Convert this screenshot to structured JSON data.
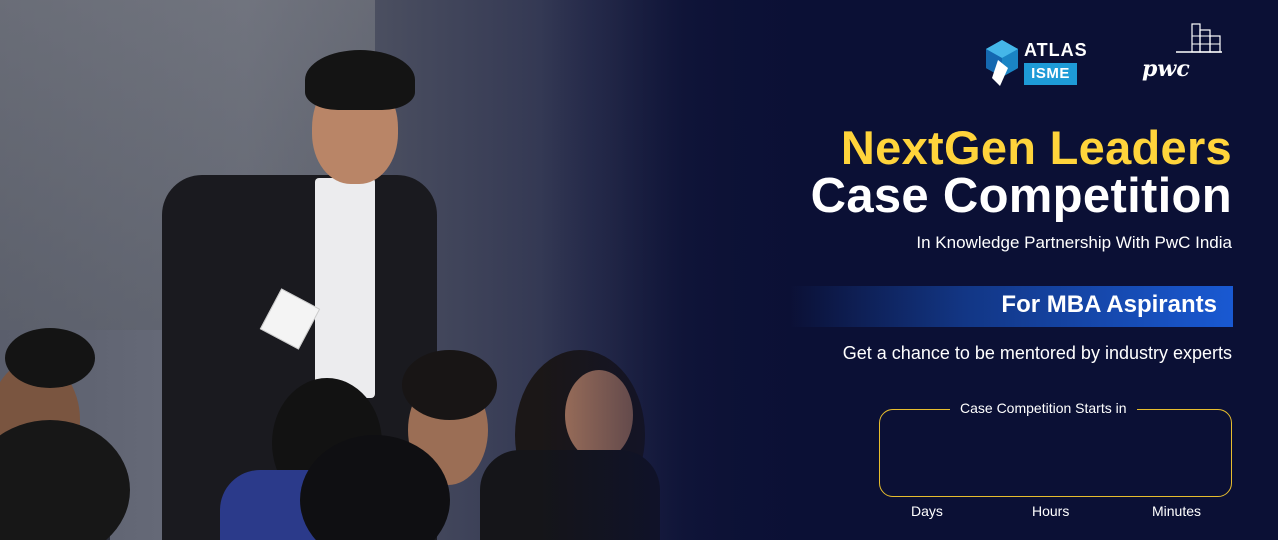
{
  "logos": {
    "atlas_word": "ATLAS",
    "isme_word": "ISME",
    "pwc_word": "pwc"
  },
  "heading": {
    "line1": "NextGen Leaders",
    "line2": "Case Competition",
    "subtitle": "In Knowledge Partnership With PwC India"
  },
  "audience_tag": "For MBA Aspirants",
  "tagline": "Get a chance to be mentored by industry experts",
  "countdown": {
    "label": "Case Competition Starts in",
    "units": [
      "Days",
      "Hours",
      "Minutes"
    ]
  },
  "colors": {
    "background": "#0b1035",
    "accent_yellow": "#ffd43b",
    "tag_blue": "#1959d2",
    "countdown_border": "#e7bd2e",
    "isme_blue": "#1e9bd7"
  }
}
